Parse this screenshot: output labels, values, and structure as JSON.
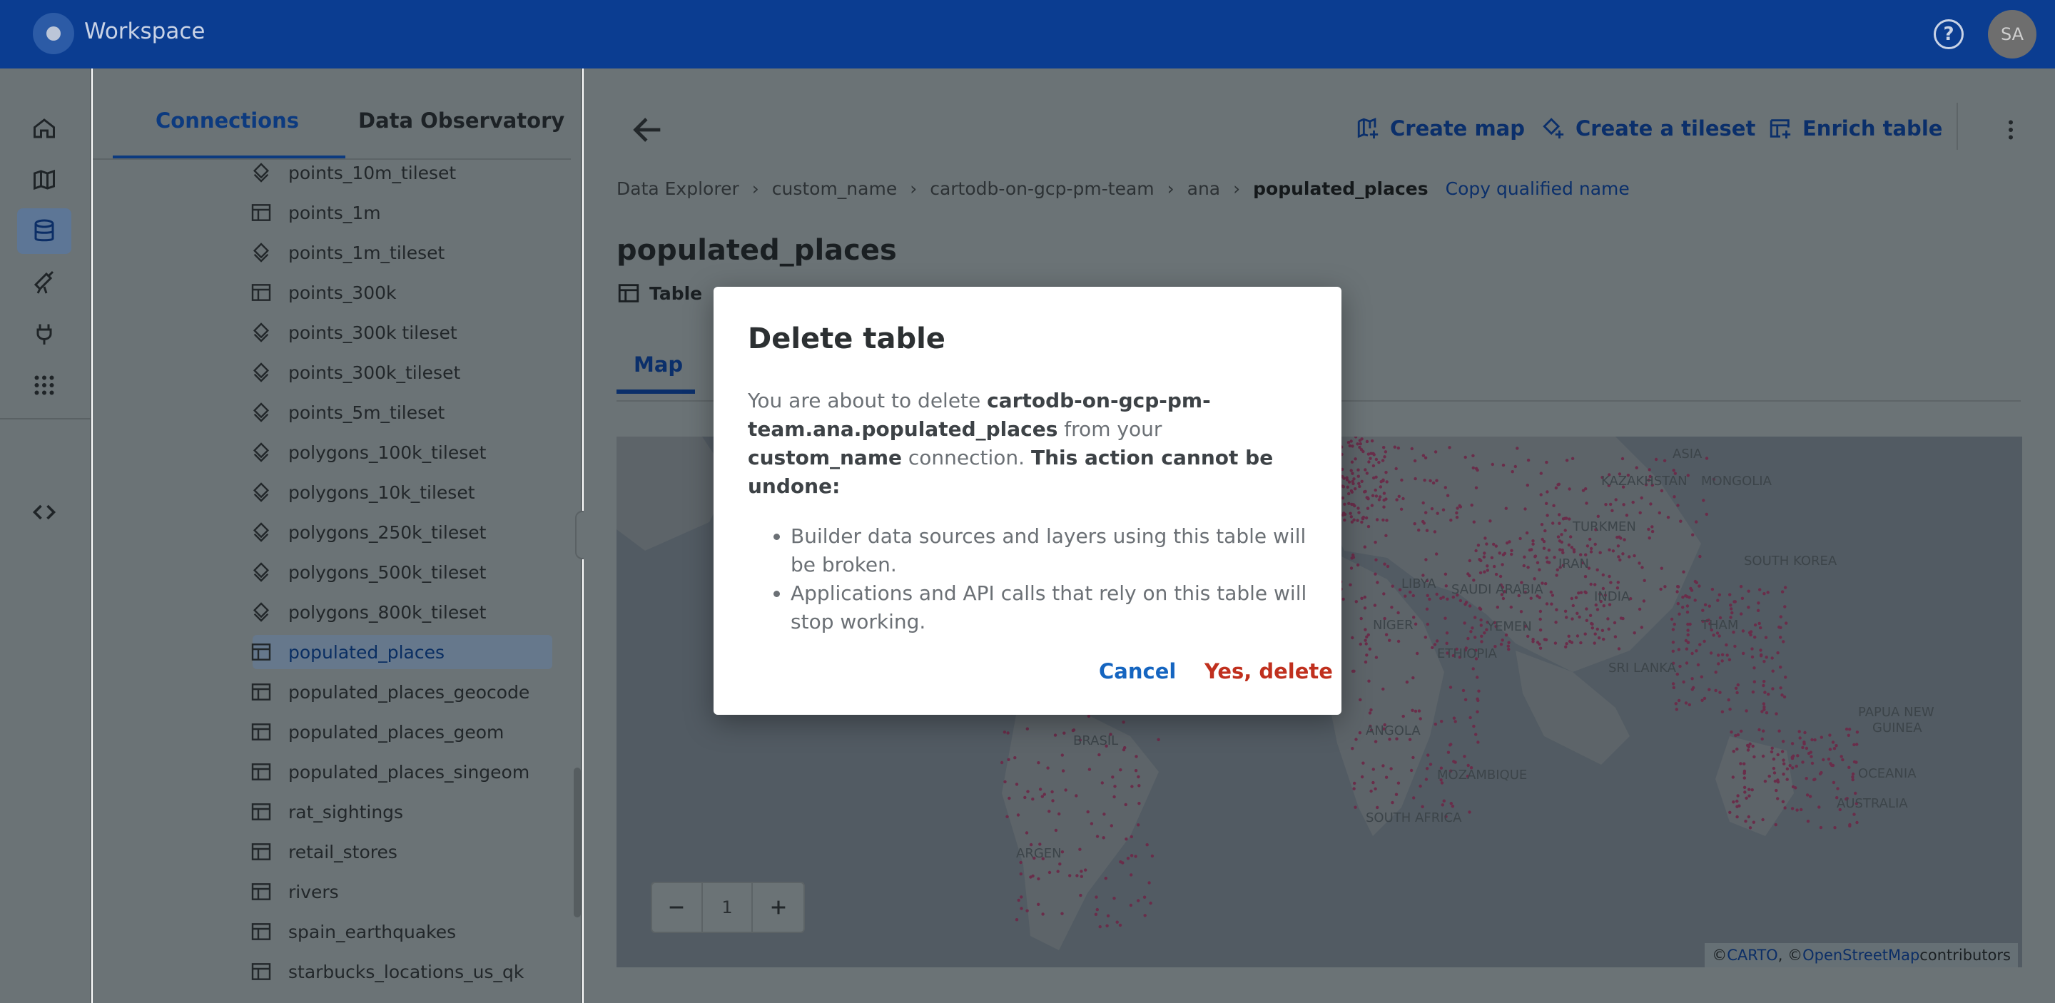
{
  "app": {
    "title": "Workspace",
    "user_initials": "SA",
    "help_glyph": "?"
  },
  "sidebar": {
    "tabs": [
      "Connections",
      "Data Observatory"
    ],
    "items": [
      {
        "label": "points_10m_tileset",
        "icon": "tileset-icon"
      },
      {
        "label": "points_1m",
        "icon": "table-icon"
      },
      {
        "label": "points_1m_tileset",
        "icon": "tileset-icon"
      },
      {
        "label": "points_300k",
        "icon": "table-icon"
      },
      {
        "label": "points_300k tileset",
        "icon": "tileset-icon"
      },
      {
        "label": "points_300k_tileset",
        "icon": "tileset-icon"
      },
      {
        "label": "points_5m_tileset",
        "icon": "tileset-icon"
      },
      {
        "label": "polygons_100k_tileset",
        "icon": "tileset-icon"
      },
      {
        "label": "polygons_10k_tileset",
        "icon": "tileset-icon"
      },
      {
        "label": "polygons_250k_tileset",
        "icon": "tileset-icon"
      },
      {
        "label": "polygons_500k_tileset",
        "icon": "tileset-icon"
      },
      {
        "label": "polygons_800k_tileset",
        "icon": "tileset-icon"
      },
      {
        "label": "populated_places",
        "icon": "table-icon",
        "selected": true
      },
      {
        "label": "populated_places_geocode",
        "icon": "table-icon"
      },
      {
        "label": "populated_places_geom",
        "icon": "table-icon"
      },
      {
        "label": "populated_places_singeom",
        "icon": "table-icon"
      },
      {
        "label": "rat_sightings",
        "icon": "table-icon"
      },
      {
        "label": "retail_stores",
        "icon": "table-icon"
      },
      {
        "label": "rivers",
        "icon": "table-icon"
      },
      {
        "label": "spain_earthquakes",
        "icon": "table-icon"
      },
      {
        "label": "starbucks_locations_us_qk",
        "icon": "table-icon"
      }
    ]
  },
  "main": {
    "actions": {
      "create_map": "Create map",
      "create_tileset": "Create a tileset",
      "enrich_table": "Enrich table"
    },
    "breadcrumb": [
      "Data Explorer",
      "custom_name",
      "cartodb-on-gcp-pm-team",
      "ana"
    ],
    "breadcrumb_current": "populated_places",
    "copy_label": "Copy qualified name",
    "title": "populated_places",
    "type_label": "Table",
    "tab_map": "Map",
    "zoom_level": "1",
    "attribution": {
      "prefix": "© ",
      "carto": "CARTO",
      "mid": ", © ",
      "osm": "OpenStreetMap",
      "suffix": " contributors"
    }
  },
  "modal": {
    "title": "Delete table",
    "text_1": "You are about to delete ",
    "table_name": "cartodb-on-gcp-pm-team.ana.populated_places",
    "text_2": " from your ",
    "connection_name": "custom_name",
    "text_3": " connection. ",
    "warning": "This action cannot be undone:",
    "bullets": [
      "Builder data sources and layers using this table will be broken.",
      "Applications and API calls that rely on this table will stop working."
    ],
    "cancel": "Cancel",
    "confirm": "Yes, delete"
  },
  "colors": {
    "accent": "#1565c0",
    "danger": "#c0301e",
    "topbar": "#0b3d91"
  }
}
